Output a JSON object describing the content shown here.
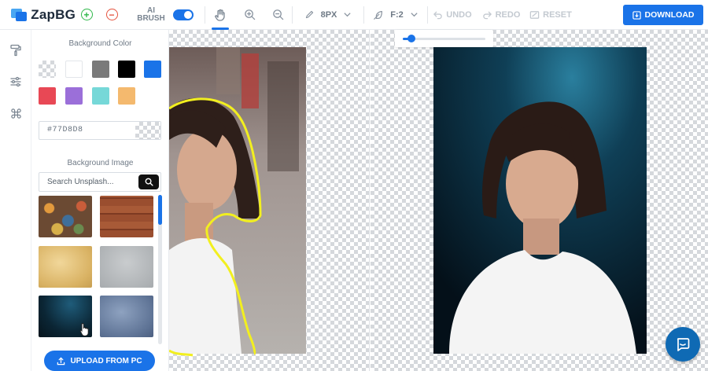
{
  "app": {
    "name": "ZapBG"
  },
  "toolbar": {
    "ai_brush_line1": "AI",
    "ai_brush_line2": "BRUSH",
    "ai_brush_enabled": true,
    "brush_size": "8PX",
    "feather": "F:2",
    "undo": "UNDO",
    "redo": "REDO",
    "reset": "RESET",
    "download": "DOWNLOAD"
  },
  "panel": {
    "background_color_title": "Background Color",
    "swatch_colors": [
      "transparent",
      "#ffffff",
      "#7a7a7a",
      "#000000",
      "#1a73e8",
      "#e84855",
      "#9b6fd9",
      "#76d8d8",
      "#f4b96e"
    ],
    "hex_value": "#77D8D8",
    "background_image_title": "Background Image",
    "search_placeholder": "Search Unsplash...",
    "upload_label": "UPLOAD FROM PC"
  },
  "slider": {
    "value": 0.1
  },
  "colors": {
    "accent": "#1a73e8",
    "outline": "#f2ef1f"
  }
}
